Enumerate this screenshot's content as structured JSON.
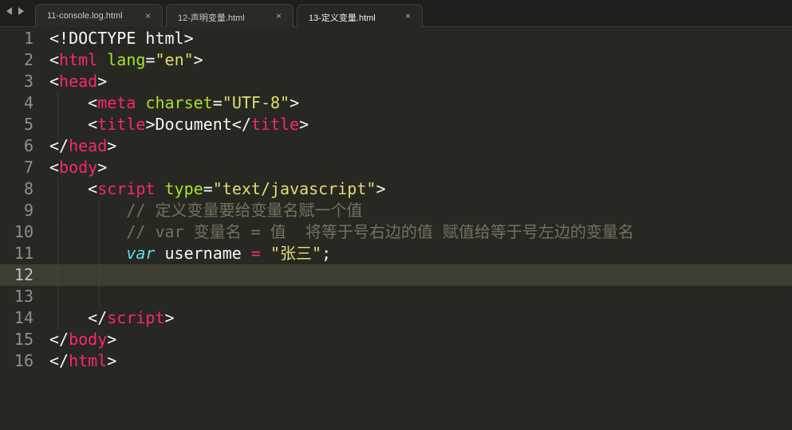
{
  "tabs": [
    {
      "label": "11-console.log.html",
      "close": "×",
      "active": false
    },
    {
      "label": "12-声明变量.html",
      "close": "×",
      "active": false
    },
    {
      "label": "13-定义变量.html",
      "close": "×",
      "active": true
    }
  ],
  "current_line": 12,
  "lines": [
    {
      "num": "1",
      "parts": [
        {
          "t": "<!DOCTYPE html>",
          "c": "plain"
        }
      ]
    },
    {
      "num": "2",
      "parts": [
        {
          "t": "<",
          "c": "plain"
        },
        {
          "t": "html",
          "c": "tag"
        },
        {
          "t": " ",
          "c": "plain"
        },
        {
          "t": "lang",
          "c": "attr"
        },
        {
          "t": "=",
          "c": "plain"
        },
        {
          "t": "\"en\"",
          "c": "str"
        },
        {
          "t": ">",
          "c": "plain"
        }
      ]
    },
    {
      "num": "3",
      "parts": [
        {
          "t": "<",
          "c": "plain"
        },
        {
          "t": "head",
          "c": "tag"
        },
        {
          "t": ">",
          "c": "plain"
        }
      ]
    },
    {
      "num": "4",
      "parts": [
        {
          "t": "    <",
          "c": "plain"
        },
        {
          "t": "meta",
          "c": "tag"
        },
        {
          "t": " ",
          "c": "plain"
        },
        {
          "t": "charset",
          "c": "attr"
        },
        {
          "t": "=",
          "c": "plain"
        },
        {
          "t": "\"UTF-8\"",
          "c": "str"
        },
        {
          "t": ">",
          "c": "plain"
        }
      ]
    },
    {
      "num": "5",
      "parts": [
        {
          "t": "    <",
          "c": "plain"
        },
        {
          "t": "title",
          "c": "tag"
        },
        {
          "t": ">Document</",
          "c": "plain"
        },
        {
          "t": "title",
          "c": "tag"
        },
        {
          "t": ">",
          "c": "plain"
        }
      ]
    },
    {
      "num": "6",
      "parts": [
        {
          "t": "</",
          "c": "plain"
        },
        {
          "t": "head",
          "c": "tag"
        },
        {
          "t": ">",
          "c": "plain"
        }
      ]
    },
    {
      "num": "7",
      "parts": [
        {
          "t": "<",
          "c": "plain"
        },
        {
          "t": "body",
          "c": "tag"
        },
        {
          "t": ">",
          "c": "plain"
        }
      ]
    },
    {
      "num": "8",
      "parts": [
        {
          "t": "    <",
          "c": "plain"
        },
        {
          "t": "script",
          "c": "tag"
        },
        {
          "t": " ",
          "c": "plain"
        },
        {
          "t": "type",
          "c": "attr"
        },
        {
          "t": "=",
          "c": "plain"
        },
        {
          "t": "\"text/javascript\"",
          "c": "str"
        },
        {
          "t": ">",
          "c": "plain"
        }
      ]
    },
    {
      "num": "9",
      "parts": [
        {
          "t": "        ",
          "c": "plain"
        },
        {
          "t": "// 定义变量要给变量名赋一个值",
          "c": "cmt"
        }
      ]
    },
    {
      "num": "10",
      "parts": [
        {
          "t": "        ",
          "c": "plain"
        },
        {
          "t": "// var 变量名 = 值  将等于号右边的值 赋值给等于号左边的变量名",
          "c": "cmt"
        }
      ]
    },
    {
      "num": "11",
      "parts": [
        {
          "t": "        ",
          "c": "plain"
        },
        {
          "t": "var",
          "c": "kw"
        },
        {
          "t": " username ",
          "c": "plain"
        },
        {
          "t": "=",
          "c": "op"
        },
        {
          "t": " ",
          "c": "plain"
        },
        {
          "t": "\"张三\"",
          "c": "str"
        },
        {
          "t": ";",
          "c": "plain"
        }
      ]
    },
    {
      "num": "12",
      "parts": []
    },
    {
      "num": "13",
      "parts": []
    },
    {
      "num": "14",
      "parts": [
        {
          "t": "    </",
          "c": "plain"
        },
        {
          "t": "script",
          "c": "tag"
        },
        {
          "t": ">",
          "c": "plain"
        }
      ]
    },
    {
      "num": "15",
      "parts": [
        {
          "t": "</",
          "c": "plain"
        },
        {
          "t": "body",
          "c": "tag"
        },
        {
          "t": ">",
          "c": "plain"
        }
      ]
    },
    {
      "num": "16",
      "parts": [
        {
          "t": "</",
          "c": "plain"
        },
        {
          "t": "html",
          "c": "tag"
        },
        {
          "t": ">",
          "c": "plain"
        }
      ]
    }
  ],
  "colors": {
    "background": "#272822",
    "tag": "#f92672",
    "attribute": "#a6e22e",
    "string": "#e6db74",
    "comment": "#75715e",
    "keyword": "#66d9ef"
  }
}
